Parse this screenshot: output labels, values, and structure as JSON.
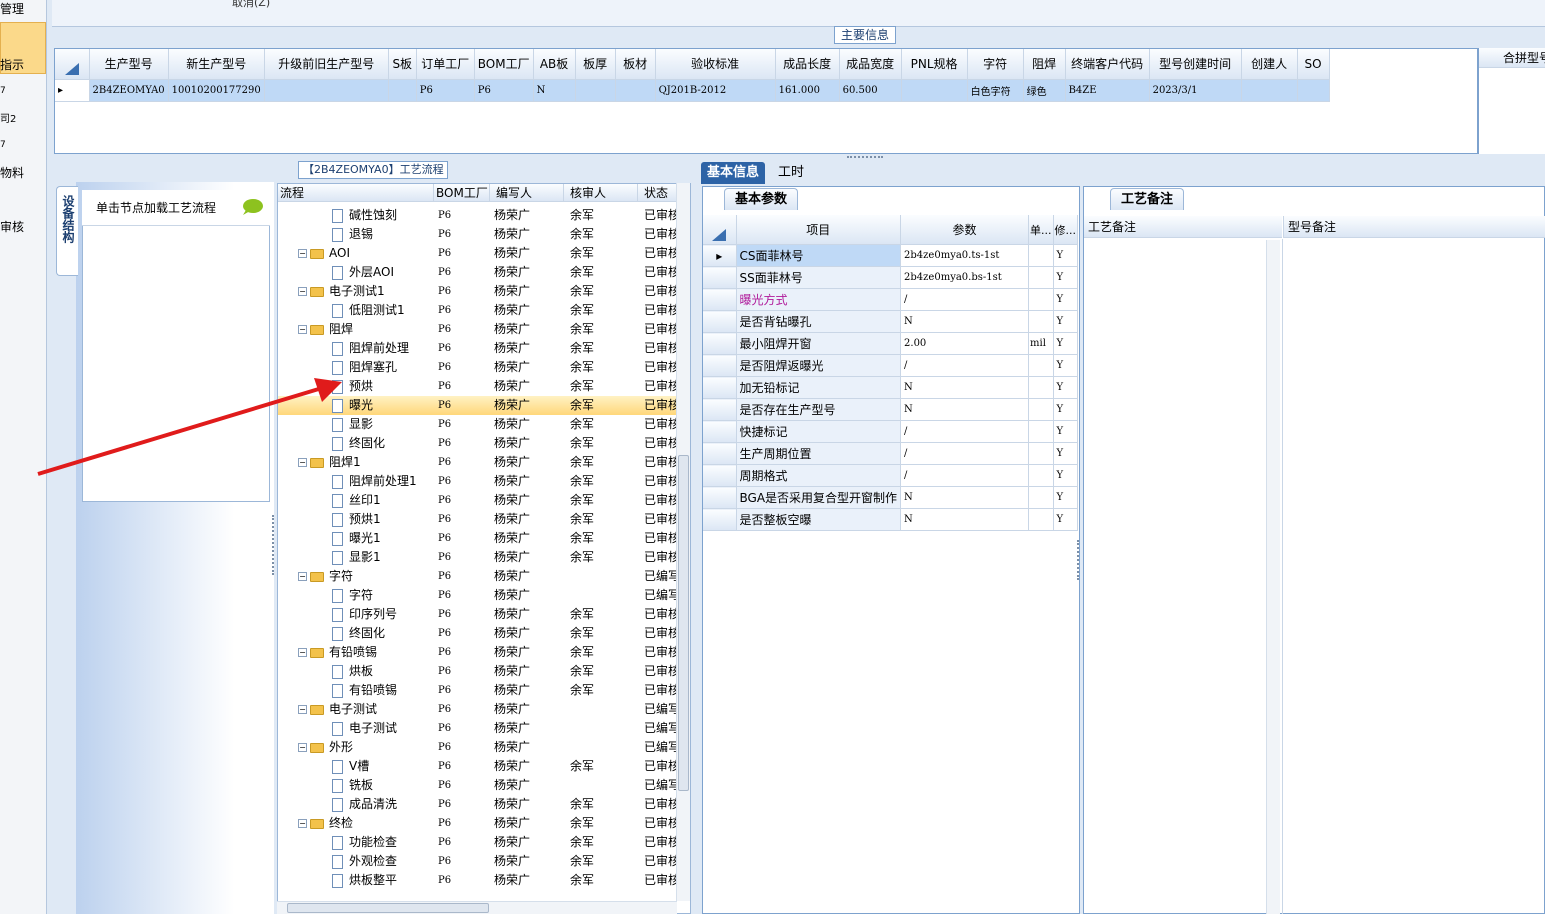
{
  "left_nav": {
    "items": [
      "管理",
      "指示",
      "7",
      "司2",
      "7",
      "物料",
      "审核"
    ]
  },
  "top_strip": {
    "text": "取消(Z)"
  },
  "main_group": {
    "title": "主要信息"
  },
  "main_grid": {
    "columns": [
      "生产型号",
      "新生产型号",
      "升级前旧生产型号",
      "S板",
      "订单工厂",
      "BOM工厂",
      "AB板",
      "板厚",
      "板材",
      "验收标准",
      "成品长度",
      "成品宽度",
      "PNL规格",
      "字符",
      "阻焊",
      "终端客户代码",
      "型号创建时间",
      "创建人",
      "SO"
    ],
    "row": [
      "2B4ZEOMYA0",
      "10010200177290",
      "",
      "",
      "P6",
      "P6",
      "N",
      "",
      "",
      "QJ201B-2012",
      "161.000",
      "60.500",
      "",
      "白色字符",
      "绿色",
      "B4ZE",
      "2023/3/1",
      "",
      ""
    ]
  },
  "right_side": {
    "header": "合拼型号"
  },
  "process": {
    "caption": "【2B4ZEOMYA0】工艺流程",
    "load_hint": "单击节点加载工艺流程",
    "vertical_tab": "设备结构"
  },
  "tree": {
    "columns": [
      "流程",
      "BOM工厂",
      "编写人",
      "核审人",
      "状态"
    ],
    "rows": [
      {
        "name": "碱性蚀刻",
        "level": 2,
        "folder": false,
        "bom": "P6",
        "writer": "杨荣广",
        "reviewer": "余军",
        "status": "已审核"
      },
      {
        "name": "退锡",
        "level": 2,
        "folder": false,
        "bom": "P6",
        "writer": "杨荣广",
        "reviewer": "余军",
        "status": "已审核"
      },
      {
        "name": "AOI",
        "level": 1,
        "folder": true,
        "bom": "P6",
        "writer": "杨荣广",
        "reviewer": "余军",
        "status": "已审核"
      },
      {
        "name": "外层AOI",
        "level": 2,
        "folder": false,
        "bom": "P6",
        "writer": "杨荣广",
        "reviewer": "余军",
        "status": "已审核"
      },
      {
        "name": "电子测试1",
        "level": 1,
        "folder": true,
        "bom": "P6",
        "writer": "杨荣广",
        "reviewer": "余军",
        "status": "已审核"
      },
      {
        "name": "低阻测试1",
        "level": 2,
        "folder": false,
        "bom": "P6",
        "writer": "杨荣广",
        "reviewer": "余军",
        "status": "已审核"
      },
      {
        "name": "阻焊",
        "level": 1,
        "folder": true,
        "bom": "P6",
        "writer": "杨荣广",
        "reviewer": "余军",
        "status": "已审核"
      },
      {
        "name": "阻焊前处理",
        "level": 2,
        "folder": false,
        "bom": "P6",
        "writer": "杨荣广",
        "reviewer": "余军",
        "status": "已审核"
      },
      {
        "name": "阻焊塞孔",
        "level": 2,
        "folder": false,
        "bom": "P6",
        "writer": "杨荣广",
        "reviewer": "余军",
        "status": "已审核"
      },
      {
        "name": "预烘",
        "level": 2,
        "folder": false,
        "bom": "P6",
        "writer": "杨荣广",
        "reviewer": "余军",
        "status": "已审核"
      },
      {
        "name": "曝光",
        "level": 2,
        "folder": false,
        "bom": "P6",
        "writer": "杨荣广",
        "reviewer": "余军",
        "status": "已审核",
        "selected": true
      },
      {
        "name": "显影",
        "level": 2,
        "folder": false,
        "bom": "P6",
        "writer": "杨荣广",
        "reviewer": "余军",
        "status": "已审核"
      },
      {
        "name": "终固化",
        "level": 2,
        "folder": false,
        "bom": "P6",
        "writer": "杨荣广",
        "reviewer": "余军",
        "status": "已审核"
      },
      {
        "name": "阻焊1",
        "level": 1,
        "folder": true,
        "bom": "P6",
        "writer": "杨荣广",
        "reviewer": "余军",
        "status": "已审核"
      },
      {
        "name": "阻焊前处理1",
        "level": 2,
        "folder": false,
        "bom": "P6",
        "writer": "杨荣广",
        "reviewer": "余军",
        "status": "已审核"
      },
      {
        "name": "丝印1",
        "level": 2,
        "folder": false,
        "bom": "P6",
        "writer": "杨荣广",
        "reviewer": "余军",
        "status": "已审核"
      },
      {
        "name": "预烘1",
        "level": 2,
        "folder": false,
        "bom": "P6",
        "writer": "杨荣广",
        "reviewer": "余军",
        "status": "已审核"
      },
      {
        "name": "曝光1",
        "level": 2,
        "folder": false,
        "bom": "P6",
        "writer": "杨荣广",
        "reviewer": "余军",
        "status": "已审核"
      },
      {
        "name": "显影1",
        "level": 2,
        "folder": false,
        "bom": "P6",
        "writer": "杨荣广",
        "reviewer": "余军",
        "status": "已审核"
      },
      {
        "name": "字符",
        "level": 1,
        "folder": true,
        "bom": "P6",
        "writer": "杨荣广",
        "reviewer": "",
        "status": "已编写"
      },
      {
        "name": "字符",
        "level": 2,
        "folder": false,
        "bom": "P6",
        "writer": "杨荣广",
        "reviewer": "",
        "status": "已编写"
      },
      {
        "name": "印序列号",
        "level": 2,
        "folder": false,
        "bom": "P6",
        "writer": "杨荣广",
        "reviewer": "余军",
        "status": "已审核"
      },
      {
        "name": "终固化",
        "level": 2,
        "folder": false,
        "bom": "P6",
        "writer": "杨荣广",
        "reviewer": "余军",
        "status": "已审核"
      },
      {
        "name": "有铅喷锡",
        "level": 1,
        "folder": true,
        "bom": "P6",
        "writer": "杨荣广",
        "reviewer": "余军",
        "status": "已审核"
      },
      {
        "name": "烘板",
        "level": 2,
        "folder": false,
        "bom": "P6",
        "writer": "杨荣广",
        "reviewer": "余军",
        "status": "已审核"
      },
      {
        "name": "有铅喷锡",
        "level": 2,
        "folder": false,
        "bom": "P6",
        "writer": "杨荣广",
        "reviewer": "余军",
        "status": "已审核"
      },
      {
        "name": "电子测试",
        "level": 1,
        "folder": true,
        "bom": "P6",
        "writer": "杨荣广",
        "reviewer": "",
        "status": "已编写"
      },
      {
        "name": "电子测试",
        "level": 2,
        "folder": false,
        "bom": "P6",
        "writer": "杨荣广",
        "reviewer": "",
        "status": "已编写"
      },
      {
        "name": "外形",
        "level": 1,
        "folder": true,
        "bom": "P6",
        "writer": "杨荣广",
        "reviewer": "",
        "status": "已编写"
      },
      {
        "name": "V槽",
        "level": 2,
        "folder": false,
        "bom": "P6",
        "writer": "杨荣广",
        "reviewer": "余军",
        "status": "已审核"
      },
      {
        "name": "铣板",
        "level": 2,
        "folder": false,
        "bom": "P6",
        "writer": "杨荣广",
        "reviewer": "",
        "status": "已编写"
      },
      {
        "name": "成品清洗",
        "level": 2,
        "folder": false,
        "bom": "P6",
        "writer": "杨荣广",
        "reviewer": "余军",
        "status": "已审核"
      },
      {
        "name": "终检",
        "level": 1,
        "folder": true,
        "bom": "P6",
        "writer": "杨荣广",
        "reviewer": "余军",
        "status": "已审核"
      },
      {
        "name": "功能检查",
        "level": 2,
        "folder": false,
        "bom": "P6",
        "writer": "杨荣广",
        "reviewer": "余军",
        "status": "已审核"
      },
      {
        "name": "外观检查",
        "level": 2,
        "folder": false,
        "bom": "P6",
        "writer": "杨荣广",
        "reviewer": "余军",
        "status": "已审核"
      },
      {
        "name": "烘板整平",
        "level": 2,
        "folder": false,
        "bom": "P6",
        "writer": "杨荣广",
        "reviewer": "余军",
        "status": "已审核"
      }
    ]
  },
  "right_tabs": {
    "basic": "基本信息",
    "hours": "工时"
  },
  "params": {
    "subtab": "基本参数",
    "columns": [
      "项目",
      "参数",
      "单...",
      "修..."
    ],
    "rows": [
      {
        "item": "CS面菲林号",
        "value": "2b4ze0mya0.ts-1st",
        "unit": "",
        "flag": "Y",
        "highlight": true
      },
      {
        "item": "SS面菲林号",
        "value": "2b4ze0mya0.bs-1st",
        "unit": "",
        "flag": "Y"
      },
      {
        "item": "曝光方式",
        "value": "/",
        "unit": "",
        "flag": "Y",
        "magenta": true
      },
      {
        "item": "是否背钻曝孔",
        "value": "N",
        "unit": "",
        "flag": "Y"
      },
      {
        "item": "最小阻焊开窗",
        "value": "2.00",
        "unit": "mil",
        "flag": "Y"
      },
      {
        "item": "是否阻焊返曝光",
        "value": "/",
        "unit": "",
        "flag": "Y"
      },
      {
        "item": "加无铅标记",
        "value": "N",
        "unit": "",
        "flag": "Y"
      },
      {
        "item": "是否存在生产型号",
        "value": "N",
        "unit": "",
        "flag": "Y"
      },
      {
        "item": "快捷标记",
        "value": "/",
        "unit": "",
        "flag": "Y"
      },
      {
        "item": "生产周期位置",
        "value": "/",
        "unit": "",
        "flag": "Y"
      },
      {
        "item": "周期格式",
        "value": "/",
        "unit": "",
        "flag": "Y"
      },
      {
        "item": "BGA是否采用复合型开窗制作",
        "value": "N",
        "unit": "",
        "flag": "Y"
      },
      {
        "item": "是否整板空曝",
        "value": "N",
        "unit": "",
        "flag": "Y"
      }
    ]
  },
  "notes": {
    "subtab": "工艺备注",
    "process_note": "工艺备注",
    "model_note": "型号备注"
  },
  "colors": {
    "accent": "#2d63a6",
    "selection": "#ffd77a",
    "arrow": "#e01b1b",
    "grid_row": "#bfd9f6"
  }
}
